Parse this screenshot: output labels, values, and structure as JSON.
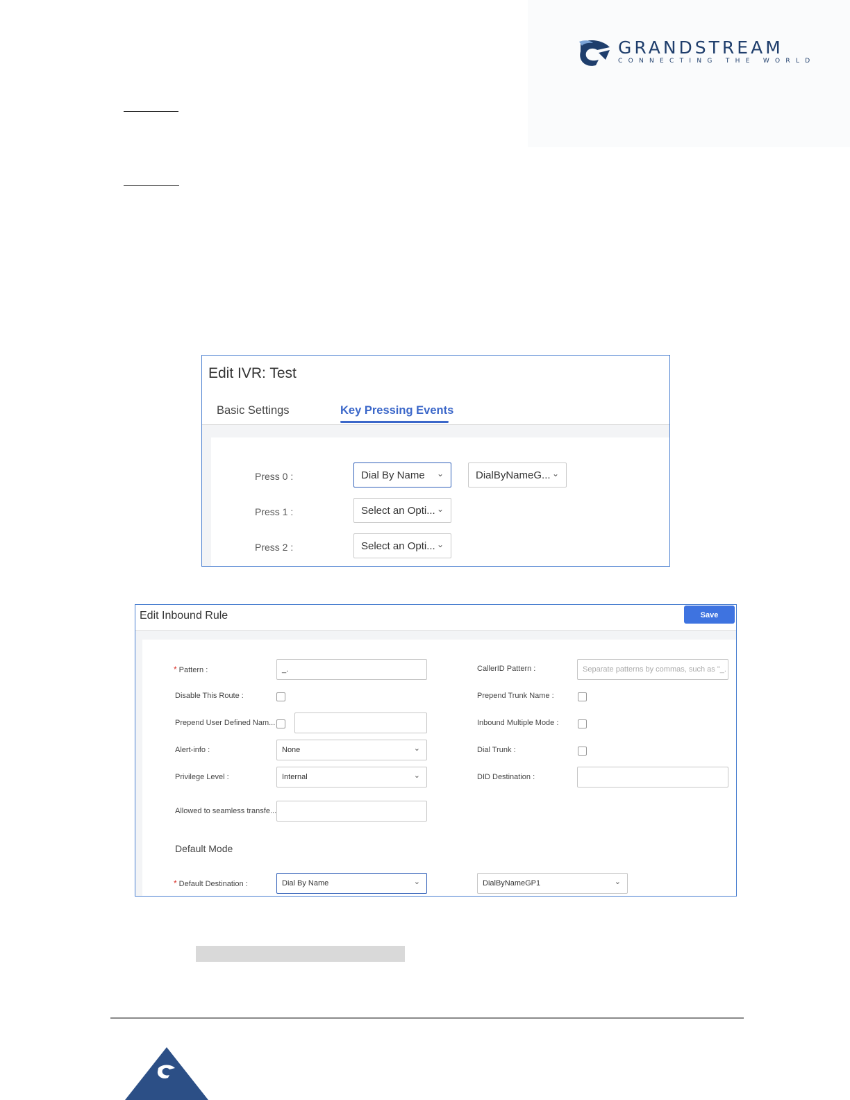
{
  "brand": {
    "name": "GRANDSTREAM",
    "tagline": "CONNECTING THE WORLD",
    "color": "#1f3e6c"
  },
  "ivr_panel": {
    "title": "Edit IVR: Test",
    "tabs": [
      {
        "label": "Basic Settings",
        "active": false
      },
      {
        "label": "Key Pressing Events",
        "active": true
      }
    ],
    "rows": [
      {
        "label": "Press 0 :",
        "option": "Dial By Name",
        "target": "DialByNameG..."
      },
      {
        "label": "Press 1 :",
        "option": "Select an Opti..."
      },
      {
        "label": "Press 2 :",
        "option": "Select an Opti..."
      }
    ],
    "accent": "#3b67c9"
  },
  "inbound_panel": {
    "title": "Edit Inbound Rule",
    "save_label": "Save",
    "fields": {
      "pattern": {
        "label": "Pattern :",
        "value": "_."
      },
      "callerid_pattern": {
        "label": "CallerID Pattern :",
        "placeholder": "Separate patterns by commas, such as \"_."
      },
      "disable_route": {
        "label": "Disable This Route :",
        "checked": false
      },
      "prepend_trunk_name": {
        "label": "Prepend Trunk Name :",
        "checked": false
      },
      "prepend_user_defined": {
        "label": "Prepend User Defined Nam...",
        "checked": false,
        "value": ""
      },
      "inbound_multiple_mode": {
        "label": "Inbound Multiple Mode :",
        "checked": false
      },
      "alert_info": {
        "label": "Alert-info :",
        "value": "None"
      },
      "dial_trunk": {
        "label": "Dial Trunk :",
        "checked": false
      },
      "privilege_level": {
        "label": "Privilege Level :",
        "value": "Internal"
      },
      "did_destination": {
        "label": "DID Destination :",
        "value": ""
      },
      "seamless_transfer": {
        "label": "Allowed to seamless transfe...",
        "value": ""
      }
    },
    "default_mode": {
      "heading": "Default Mode",
      "destination_label": "Default Destination :",
      "destination_value": "Dial By Name",
      "destination_target": "DialByNameGP1"
    },
    "save_color": "#3e73e0",
    "required_color": "#d9342b"
  },
  "icons": {
    "chevron": "chevron-down-icon",
    "logo": "grandstream-logo-icon",
    "footer": "grandstream-footer-icon"
  }
}
